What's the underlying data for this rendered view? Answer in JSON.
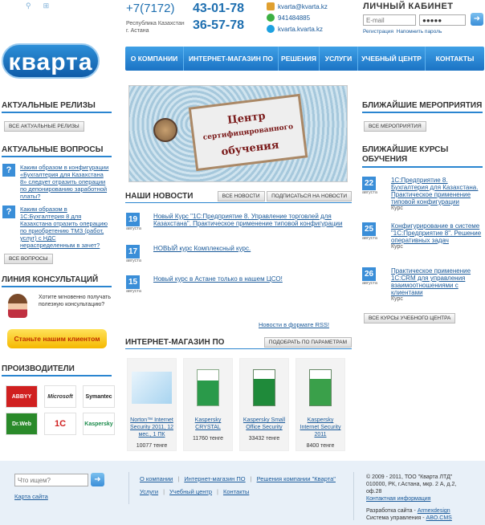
{
  "header": {
    "logo_text": "кварта",
    "phone_code": "+7(7172)",
    "phone_1": "43-01-78",
    "phone_2": "36-57-78",
    "region_line1": "Республика Казахстан",
    "region_line2": "г. Астана",
    "email": "kvarta@kvarta.kz",
    "icq": "941484885",
    "skype": "kvarta.kvarta.kz",
    "cabinet_title": "ЛИЧНЫЙ КАБИНЕТ",
    "email_placeholder": "E-mail",
    "password_value": "●●●●●",
    "register": "Регистрация",
    "remind": "Напомнить пароль"
  },
  "nav": [
    "О КОМПАНИИ",
    "ИНТЕРНЕТ-МАГАЗИН ПО",
    "РЕШЕНИЯ",
    "УСЛУГИ",
    "УЧЕБНЫЙ ЦЕНТР",
    "КОНТАКТЫ"
  ],
  "left": {
    "releases_title": "АКТУАЛЬНЫЕ РЕЛИЗЫ",
    "releases_btn": "ВСЕ АКТУАЛЬНЫЕ РЕЛИЗЫ",
    "questions_title": "АКТУАЛЬНЫЕ ВОПРОСЫ",
    "questions": [
      "Каким образом в конфигурации «Бухгалтерия для Казахстана 8» следует отразить операции по депонированию заработной платы?",
      "Каким образом в 1С:Бухгалтерия 8 для Казахстана отразить операцию по приобретению ТМЗ (работ, услуг) с НДС нераспределенным в зачет?"
    ],
    "questions_btn": "ВСЕ ВОПРОСЫ",
    "consult_title": "ЛИНИЯ КОНСУЛЬТАЦИЙ",
    "consult_text": "Хотите мгновенно получать полезную консультацию?",
    "consult_btn": "Станьте нашим клиентом",
    "vendors_title": "ПРОИЗВОДИТЕЛИ",
    "vendors": [
      "ABBYY",
      "Microsoft",
      "Symantec",
      "Dr.Web",
      "1С",
      "Kaspersky"
    ]
  },
  "banner": {
    "line1": "Центр",
    "line2": "сертифицированного",
    "line3": "обучения"
  },
  "news": {
    "title": "НАШИ НОВОСТИ",
    "btn_all": "ВСЕ НОВОСТИ",
    "btn_sub": "ПОДПИСАТЬСЯ НА НОВОСТИ",
    "items": [
      {
        "day": "19",
        "month": "августа",
        "text": "Новый Курс \"1С:Предприятие 8. Управление торговлей для Казахстана\". Практическое применение типовой конфигурации"
      },
      {
        "day": "17",
        "month": "августа",
        "text": "НОВЫЙ курс Комплексный курс."
      },
      {
        "day": "15",
        "month": "августа",
        "text": "Новый курс в Астане только в нашем ЦСО!"
      }
    ],
    "rss": "Новости в формате RSS!"
  },
  "shop": {
    "title": "ИНТЕРНЕТ-МАГАЗИН ПО",
    "btn": "ПОДОБРАТЬ ПО ПАРАМЕТРАМ",
    "products": [
      {
        "name": "Norton™ Internet Security 2011, 12 мес., 1 ПК",
        "price": "10077 тенге"
      },
      {
        "name": "Kaspersky CRYSTAL",
        "price": "11760 тенге"
      },
      {
        "name": "Kaspersky Small Office Security",
        "price": "33432 тенге"
      },
      {
        "name": "Kaspersky Internet Security 2011",
        "price": "8400 тенге"
      }
    ]
  },
  "right": {
    "events_title": "БЛИЖАЙШИЕ МЕРОПРИЯТИЯ",
    "events_btn": "ВСЕ МЕРОПРИЯТИЯ",
    "courses_title_1": "БЛИЖАЙШИЕ КУРСЫ",
    "courses_title_2": "ОБУЧЕНИЯ",
    "courses": [
      {
        "day": "22",
        "month": "августа",
        "text": "1С:Предприятие 8. Бухгалтерия для Казахстана. Практическое применение типовой конфигурации",
        "type": "Курс"
      },
      {
        "day": "25",
        "month": "августа",
        "text": "Конфигурирование в системе \"1С:Предприятие 8\". Решение оперативных задач",
        "type": "Курс"
      },
      {
        "day": "26",
        "month": "августа",
        "text": "Практическое применение 1С:CRM для управления взаимоотношениями с клиентами",
        "type": "Курс"
      }
    ],
    "courses_btn": "ВСЕ КУРСЫ УЧЕБНОГО ЦЕНТРА"
  },
  "footer": {
    "search_placeholder": "Что ищем?",
    "sitemap": "Карта сайта",
    "links_row1": [
      "О компании",
      "Интернет-магазин ПО",
      "Решения компании \"Кварта\""
    ],
    "links_row2": [
      "Услуги",
      "Учебный центр",
      "Контакты"
    ],
    "copyright": "© 2009 - 2011, ТОО \"Кварта ЛТД\"",
    "address_1": "010000, РК, г.Астана, мкр. 2 А, д.2,",
    "address_2": "оф.28",
    "contact_info": "Контактная информация",
    "dev_label": "Разработка сайта -",
    "dev_name": "Armexdesign",
    "cms_label": "Система управления -",
    "cms_name": "ABO.CMS"
  }
}
